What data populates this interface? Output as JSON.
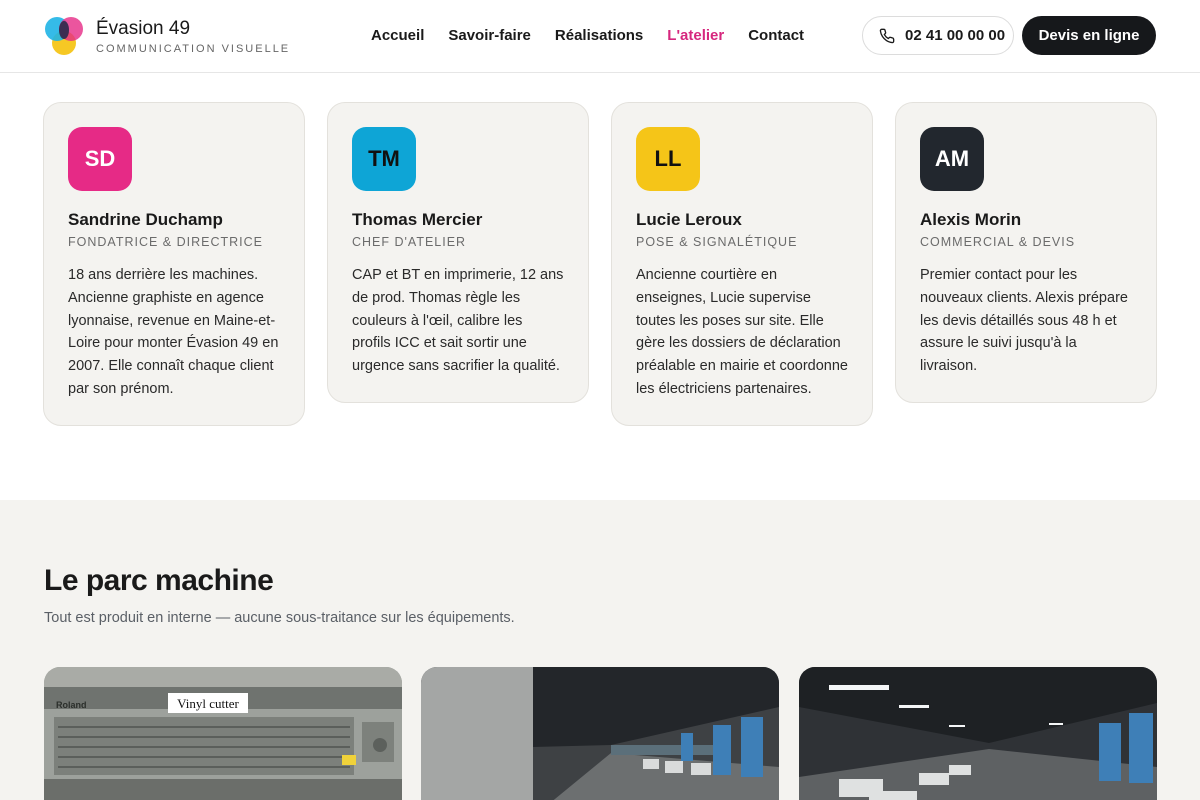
{
  "brand": {
    "name": "Évasion 49",
    "tagline": "COMMUNICATION VISUELLE"
  },
  "nav": {
    "items": [
      {
        "label": "Accueil"
      },
      {
        "label": "Savoir-faire"
      },
      {
        "label": "Réalisations"
      },
      {
        "label": "L'atelier",
        "active": true
      },
      {
        "label": "Contact"
      }
    ],
    "active_color": "#d6277e"
  },
  "header": {
    "phone": "02 41 00 00 00",
    "quote_label": "Devis en ligne"
  },
  "team": [
    {
      "initials": "SD",
      "name": "Sandrine Duchamp",
      "role": "FONDATRICE & DIRECTRICE",
      "color": "#e62a86",
      "bio": "18 ans derrière les machines. Ancienne graphiste en agence lyonnaise, revenue en Maine-et-Loire pour monter Évasion 49 en 2007. Elle connaît chaque client par son prénom."
    },
    {
      "initials": "TM",
      "name": "Thomas Mercier",
      "role": "CHEF D'ATELIER",
      "color": "#0ea5d6",
      "bio": "CAP et BT en imprimerie, 12 ans de prod. Thomas règle les couleurs à l'œil, calibre les profils ICC et sait sortir une urgence sans sacrifier la qualité."
    },
    {
      "initials": "LL",
      "name": "Lucie Leroux",
      "role": "POSE & SIGNALÉTIQUE",
      "color": "#f5c518",
      "bio": "Ancienne courtière en enseignes, Lucie supervise toutes les poses sur site. Elle gère les dossiers de déclaration préalable en mairie et coordonne les électriciens partenaires."
    },
    {
      "initials": "AM",
      "name": "Alexis Morin",
      "role": "COMMERCIAL & DEVIS",
      "color": "#22272e",
      "bio": "Premier contact pour les nouveaux clients. Alexis prépare les devis détaillés sous 48 h et assure le suivi jusqu'à la livraison."
    }
  ],
  "machines": {
    "title": "Le parc machine",
    "subtitle": "Tout est produit en interne — aucune sous-traitance sur les équipements.",
    "photos": [
      {
        "label": "Vinyl cutter",
        "brand": "Roland"
      },
      {
        "alt": "warehouse-photo"
      },
      {
        "alt": "warehouse-photo"
      }
    ]
  }
}
